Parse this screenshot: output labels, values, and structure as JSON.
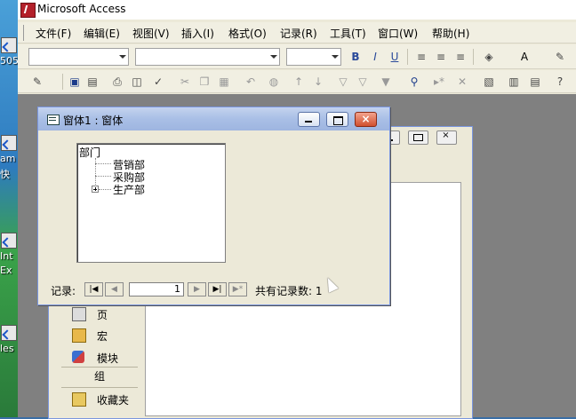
{
  "app": {
    "title": "Microsoft Access"
  },
  "menu": [
    "文件(F)",
    "编辑(E)",
    "视图(V)",
    "插入(I)",
    "格式(O)",
    "记录(R)",
    "工具(T)",
    "窗口(W)",
    "帮助(H)"
  ],
  "desktop": {
    "labels": [
      "505",
      "am",
      "快",
      "Int",
      "Ex",
      "les"
    ]
  },
  "db_window": {
    "objects": [
      {
        "label": "页",
        "icon": "page-icon"
      },
      {
        "label": "宏",
        "icon": "macro-icon"
      },
      {
        "label": "模块",
        "icon": "module-icon"
      }
    ],
    "group_label": "组",
    "favorites_label": "收藏夹"
  },
  "form": {
    "title": "窗体1 : 窗体",
    "tree": {
      "root": "部门",
      "children": [
        "营销部",
        "采购部",
        "生产部"
      ]
    },
    "nav": {
      "record_label": "记录:",
      "current": "1",
      "total_label": "共有记录数: 1"
    }
  },
  "colors": {
    "form_title_bar": "#a9bfe6",
    "close_button": "#d1502f",
    "access_icon": "#b3202a"
  }
}
